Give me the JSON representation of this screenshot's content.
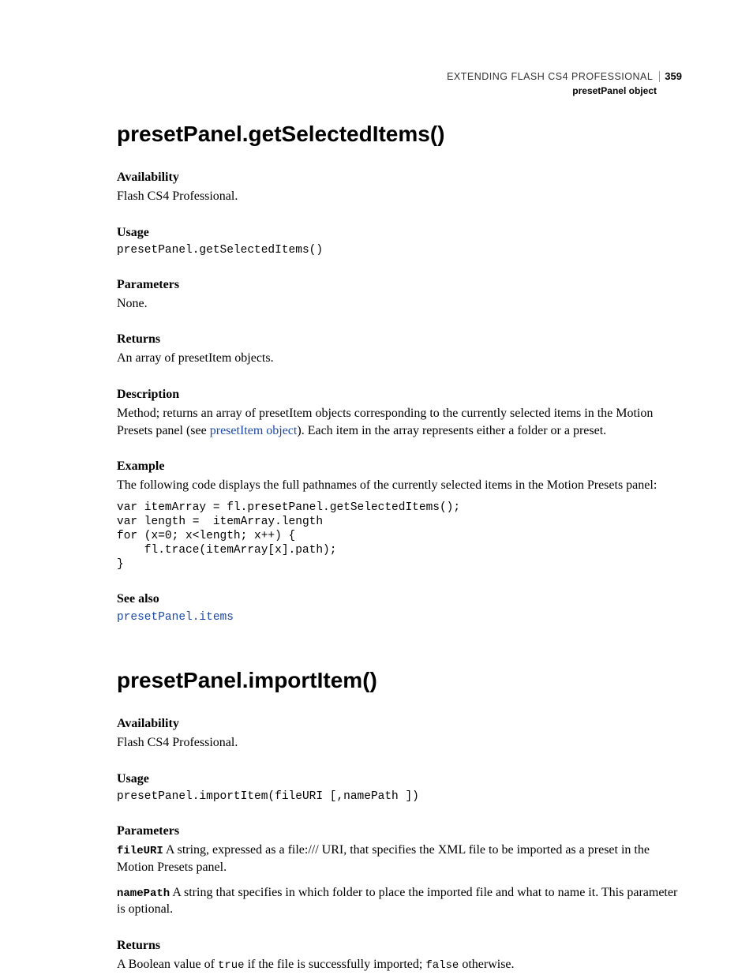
{
  "header": {
    "title": "EXTENDING FLASH CS4 PROFESSIONAL",
    "page_number": "359",
    "subtitle": "presetPanel object"
  },
  "section1": {
    "heading": "presetPanel.getSelectedItems()",
    "availability": {
      "label": "Availability",
      "text": "Flash CS4 Professional."
    },
    "usage": {
      "label": "Usage",
      "code": "presetPanel.getSelectedItems()"
    },
    "parameters": {
      "label": "Parameters",
      "text": "None."
    },
    "returns": {
      "label": "Returns",
      "text": "An array of presetItem objects."
    },
    "description": {
      "label": "Description",
      "text_before": "Method; returns an array of presetItem objects corresponding to the currently selected items in the Motion Presets panel (see ",
      "link": "presetItem object",
      "text_after": "). Each item in the array represents either a folder or a preset."
    },
    "example": {
      "label": "Example",
      "intro": "The following code displays the full pathnames of the currently selected items in the Motion Presets panel:",
      "code": "var itemArray = fl.presetPanel.getSelectedItems();\nvar length =  itemArray.length\nfor (x=0; x<length; x++) {\n    fl.trace(itemArray[x].path);\n}"
    },
    "seealso": {
      "label": "See also",
      "link": "presetPanel.items"
    }
  },
  "section2": {
    "heading": "presetPanel.importItem()",
    "availability": {
      "label": "Availability",
      "text": "Flash CS4 Professional."
    },
    "usage": {
      "label": "Usage",
      "code": "presetPanel.importItem(fileURI [,namePath ])"
    },
    "parameters": {
      "label": "Parameters",
      "p1_name": "fileURI",
      "p1_text": "  A string, expressed as a file:/// URI, that specifies the XML file to be imported as a preset in the Motion Presets panel.",
      "p2_name": "namePath",
      "p2_text": "  A string that specifies in which folder to place the imported file and what to name it. This parameter is optional."
    },
    "returns": {
      "label": "Returns",
      "t1": "A Boolean value of ",
      "c1": "true",
      "t2": " if the file is successfully imported; ",
      "c2": "false",
      "t3": " otherwise."
    }
  }
}
